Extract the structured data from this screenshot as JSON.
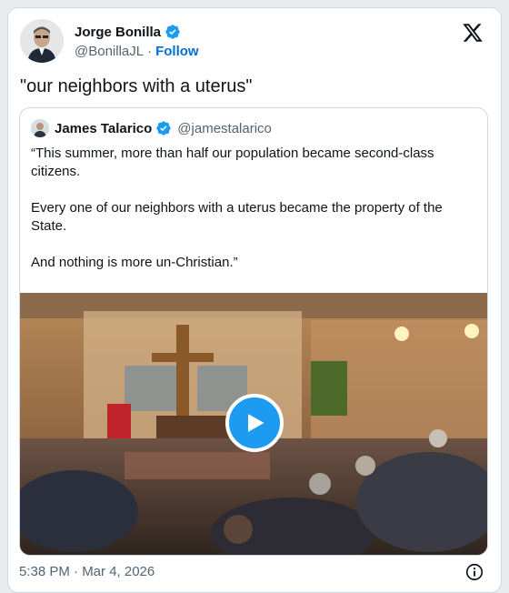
{
  "tweet": {
    "author_name": "Jorge Bonilla",
    "author_handle": "@BonillaJL",
    "separator": "·",
    "follow_label": "Follow",
    "text": "\"our neighbors with a uterus\"",
    "timestamp": "5:38 PM · Mar 4, 2026"
  },
  "quoted": {
    "author_name": "James Talarico",
    "author_handle": "@jamestalarico",
    "paragraphs": [
      "“This summer, more than half our population became second-class citizens.",
      "Every one of our neighbors with a uterus became the property of the State.",
      "And nothing is more un-Christian.”"
    ]
  },
  "icons": {
    "verified": "verified-badge-icon",
    "brand": "x-logo-icon",
    "play": "play-icon",
    "info": "info-icon"
  },
  "colors": {
    "accent": "#1d9bf0",
    "follow": "#006fd6",
    "text": "#0f1419",
    "muted": "#536471",
    "border": "#cfd9de"
  }
}
